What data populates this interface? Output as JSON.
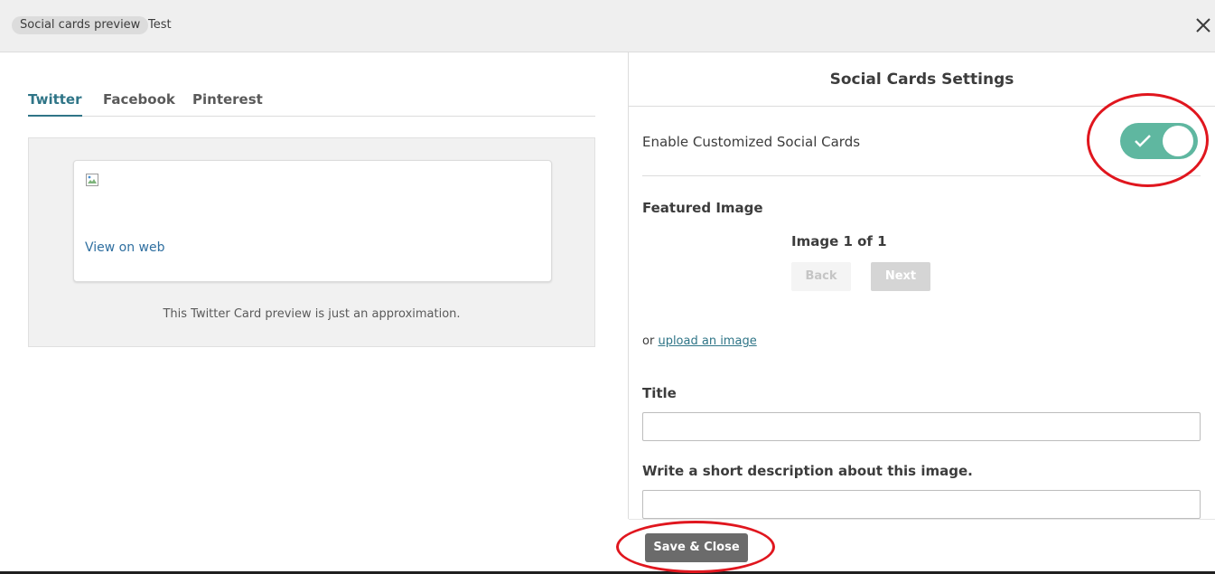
{
  "header": {
    "breadcrumb_pill": "Social cards preview",
    "breadcrumb_current": "Test",
    "close_icon": "close-x-icon"
  },
  "preview": {
    "tabs": [
      {
        "label": "Twitter",
        "active": true
      },
      {
        "label": "Facebook",
        "active": false
      },
      {
        "label": "Pinterest",
        "active": false
      }
    ],
    "card": {
      "image_icon": "broken-image-icon",
      "view_link": "View on web"
    },
    "note": "This Twitter Card preview is just an approximation."
  },
  "settings": {
    "title": "Social Cards Settings",
    "enable_label": "Enable Customized Social Cards",
    "enable_on": true,
    "toggle_icon": "checkmark-icon",
    "featured_image_label": "Featured Image",
    "image_counter": "Image 1 of 1",
    "back_label": "Back",
    "next_label": "Next",
    "upload_prefix": "or",
    "upload_link": "upload an image",
    "title_label": "Title",
    "title_value": "",
    "description_label": "Write a short description about this image.",
    "description_value": ""
  },
  "footer": {
    "save_label": "Save & Close"
  },
  "colors": {
    "accent_teal": "#2f7587",
    "toggle_green": "#5fb7a0",
    "save_button": "#6b6b6b",
    "annotation_red": "#e0161e"
  }
}
